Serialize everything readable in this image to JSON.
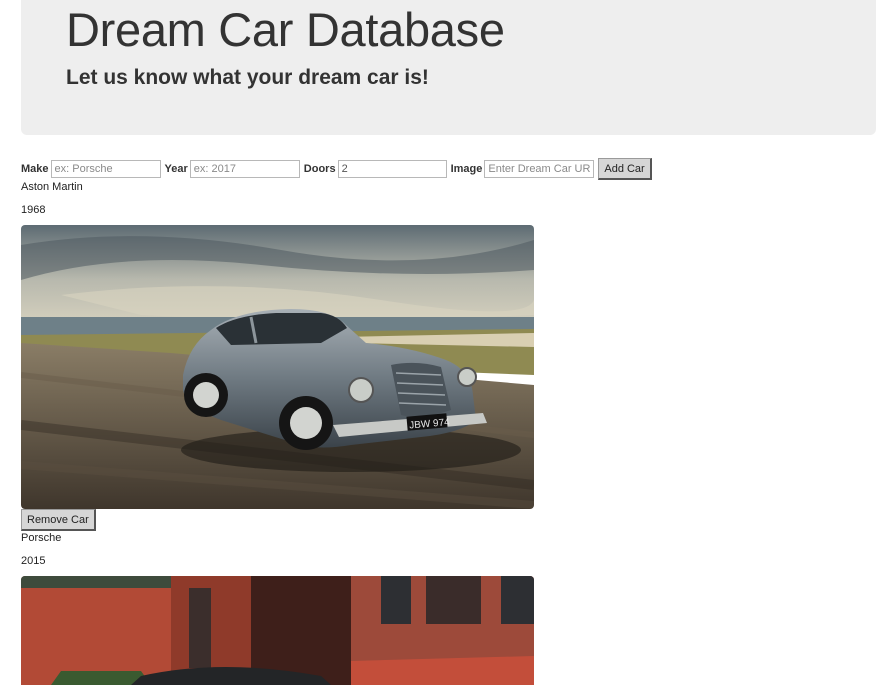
{
  "header": {
    "title": "Dream Car Database",
    "subtitle": "Let us know what your dream car is!"
  },
  "form": {
    "make_label": "Make",
    "make_placeholder": "ex: Porsche",
    "year_label": "Year",
    "year_placeholder": "ex: 2017",
    "doors_label": "Doors",
    "doors_value": "2",
    "image_label": "Image",
    "image_placeholder": "Enter Dream Car URL",
    "add_button": "Add Car"
  },
  "cars": [
    {
      "make": "Aston Martin",
      "year": "1968",
      "plate": "JBW 974",
      "remove_button": "Remove Car"
    },
    {
      "make": "Porsche",
      "year": "2015"
    }
  ]
}
